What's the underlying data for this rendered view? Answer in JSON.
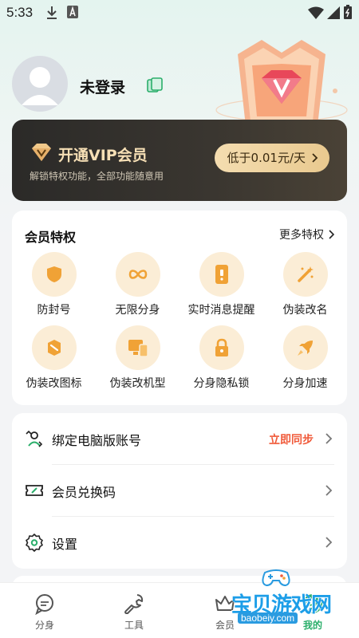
{
  "status_bar": {
    "time": "5:33"
  },
  "profile": {
    "username": "未登录"
  },
  "vip": {
    "title": "开通VIP会员",
    "subtitle": "解锁特权功能，全部功能随意用",
    "button": "低于0.01元/天"
  },
  "privileges": {
    "title": "会员特权",
    "more": "更多特权",
    "items": [
      {
        "label": "防封号",
        "icon": "shield-icon"
      },
      {
        "label": "无限分身",
        "icon": "infinity-icon"
      },
      {
        "label": "实时消息提醒",
        "icon": "phone-notify-icon"
      },
      {
        "label": "伪装改名",
        "icon": "magic-wand-icon"
      },
      {
        "label": "伪装改图标",
        "icon": "badge-icon"
      },
      {
        "label": "伪装改机型",
        "icon": "device-icon"
      },
      {
        "label": "分身隐私锁",
        "icon": "lock-icon"
      },
      {
        "label": "分身加速",
        "icon": "rocket-icon"
      }
    ]
  },
  "settings_list": {
    "items": [
      {
        "label": "绑定电脑版账号",
        "action": "立即同步",
        "icon": "pc-bind-icon"
      },
      {
        "label": "会员兑换码",
        "action": "",
        "icon": "ticket-icon"
      },
      {
        "label": "设置",
        "action": "",
        "icon": "gear-icon"
      }
    ]
  },
  "bottom_nav": {
    "items": [
      {
        "label": "分身",
        "icon": "chat-icon"
      },
      {
        "label": "工具",
        "icon": "wrench-icon"
      },
      {
        "label": "会员",
        "icon": "crown-icon"
      },
      {
        "label": "我的",
        "icon": "profile-icon",
        "active": true
      }
    ]
  },
  "watermark": {
    "text": "宝贝游戏网",
    "url": "baobeiy.com"
  },
  "colors": {
    "accent_green": "#2aae6a",
    "vip_gold": "#f6dfb5",
    "action_red": "#f05a3a",
    "icon_orange": "#f0a236",
    "icon_bg": "#fbedd6"
  }
}
